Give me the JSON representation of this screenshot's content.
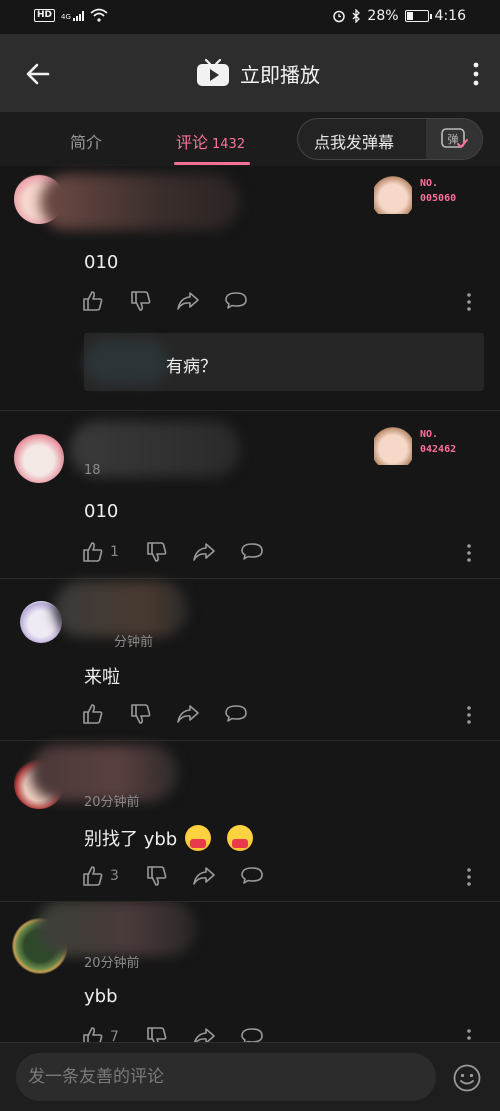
{
  "status_bar": {
    "hd": "HD",
    "network": "4G",
    "battery": "28%",
    "time": "4:16",
    "battery_level": 0.28
  },
  "app_bar": {
    "title": "立即播放"
  },
  "tabs": {
    "intro": "简介",
    "comment": "评论",
    "comment_count": "1432",
    "danmaku_button": "点我发弹幕",
    "danmaku_icon_char": "弹"
  },
  "comments": [
    {
      "name": "",
      "time": "",
      "text": "010",
      "like_count": "",
      "badge_label": "NO.",
      "badge_number": "005060",
      "reply": {
        "text": "有病？"
      }
    },
    {
      "name": "",
      "time": "18",
      "text": "010",
      "like_count": "1",
      "badge_label": "NO.",
      "badge_number": "042462"
    },
    {
      "name": "",
      "time": "分钟前",
      "text": "来啦",
      "like_count": ""
    },
    {
      "name": "",
      "time": "20分钟前",
      "text": "别找了 ybb",
      "like_count": "3"
    },
    {
      "name": "",
      "time": "20分钟前",
      "text": "ybb",
      "like_count": "7"
    }
  ],
  "bottom": {
    "input_placeholder": "发一条友善的评论"
  },
  "colors": {
    "accent": "#fb7299",
    "background": "#161616"
  }
}
